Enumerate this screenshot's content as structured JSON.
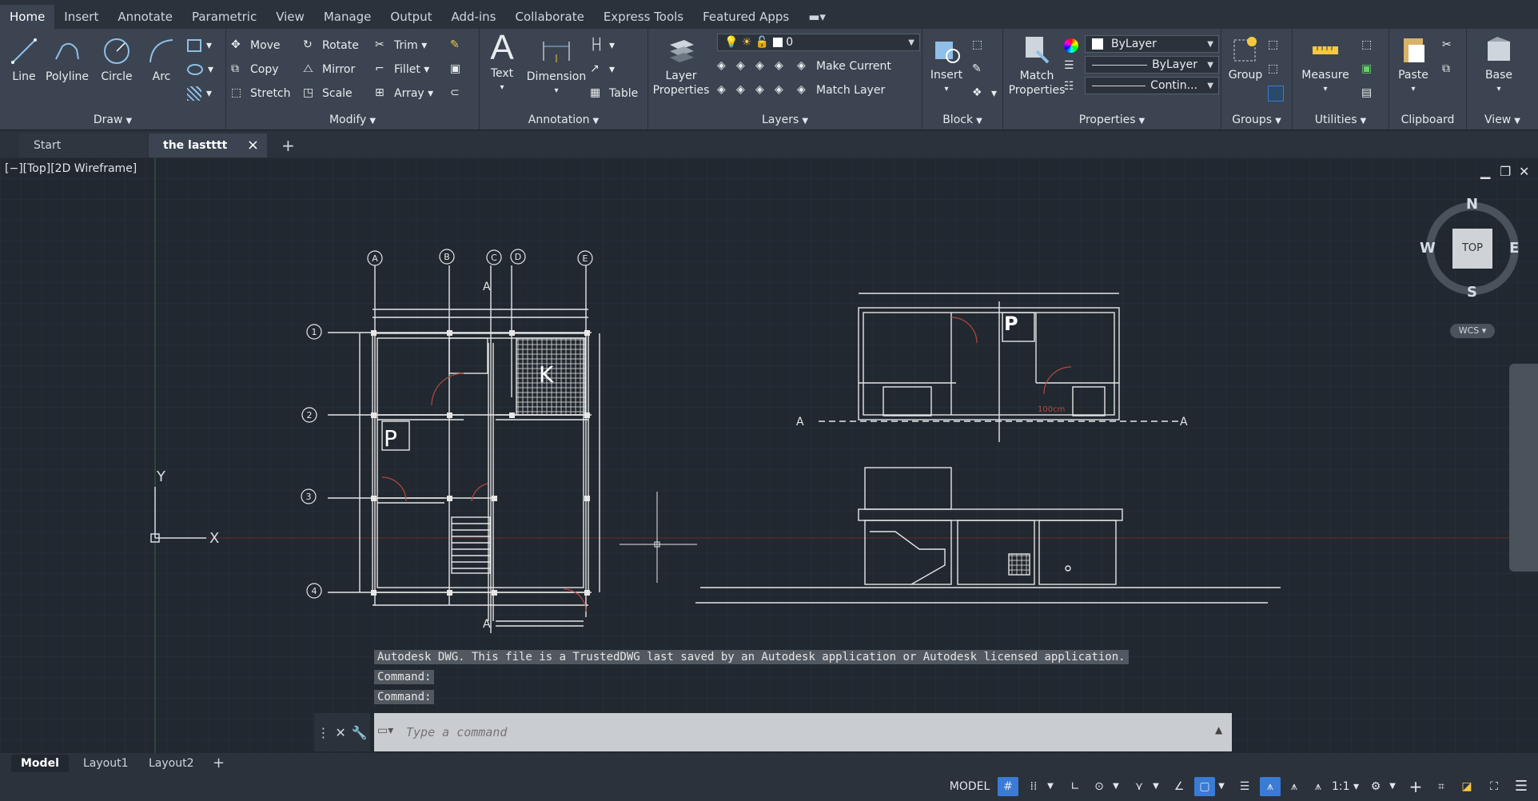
{
  "menu": [
    "Home",
    "Insert",
    "Annotate",
    "Parametric",
    "View",
    "Manage",
    "Output",
    "Add-ins",
    "Collaborate",
    "Express Tools",
    "Featured Apps"
  ],
  "ribbon": {
    "draw": {
      "title": "Draw",
      "line": "Line",
      "polyline": "Polyline",
      "circle": "Circle",
      "arc": "Arc"
    },
    "modify": {
      "title": "Modify",
      "move": "Move",
      "rotate": "Rotate",
      "trim": "Trim",
      "copy": "Copy",
      "mirror": "Mirror",
      "fillet": "Fillet",
      "stretch": "Stretch",
      "scale": "Scale",
      "array": "Array"
    },
    "annotation": {
      "title": "Annotation",
      "text": "Text",
      "dimension": "Dimension",
      "table": "Table"
    },
    "layers": {
      "title": "Layers",
      "layer_properties": "Layer Properties",
      "current_layer": "0",
      "make_current": "Make Current",
      "match_layer": "Match Layer"
    },
    "block": {
      "title": "Block",
      "insert": "Insert"
    },
    "properties": {
      "title": "Properties",
      "match_properties": "Match Properties",
      "color": "ByLayer",
      "lineweight": "ByLayer",
      "linetype": "Contin..."
    },
    "groups": {
      "title": "Groups",
      "group": "Group"
    },
    "utilities": {
      "title": "Utilities",
      "measure": "Measure"
    },
    "clipboard": {
      "title": "Clipboard",
      "paste": "Paste"
    },
    "view": {
      "title": "View",
      "base": "Base"
    }
  },
  "tabs": {
    "start": "Start",
    "active": "the lastttt"
  },
  "viewport": {
    "label": "[−][Top][2D Wireframe]"
  },
  "viewcube": {
    "n": "N",
    "s": "S",
    "e": "E",
    "w": "W",
    "top": "TOP",
    "wcs": "WCS"
  },
  "drawing": {
    "grid_cols": [
      "A",
      "B",
      "C",
      "D",
      "E"
    ],
    "grid_rows": [
      "1",
      "2",
      "3",
      "4"
    ],
    "room_k": "K",
    "room_p": "P",
    "section": "A",
    "dim_100": "100cm"
  },
  "command": {
    "history": [
      "Autodesk DWG.  This file is a TrustedDWG last saved by an Autodesk application or Autodesk licensed application.",
      "Command:",
      "Command:"
    ],
    "placeholder": "Type a command"
  },
  "layouts": [
    "Model",
    "Layout1",
    "Layout2"
  ],
  "status": {
    "model": "MODEL",
    "scale": "1:1"
  },
  "colors": {
    "accent": "#3a7bd5",
    "background": "#212830",
    "ribbon": "#3b4450"
  }
}
